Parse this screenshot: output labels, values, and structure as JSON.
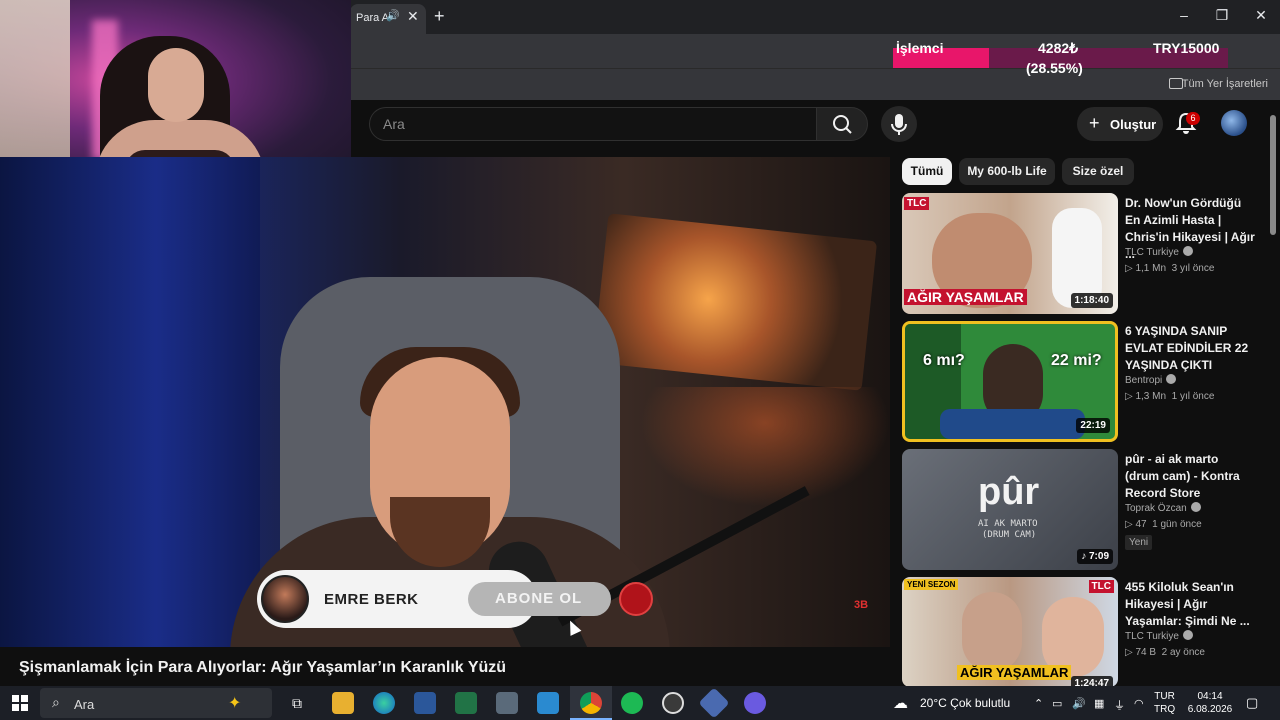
{
  "browser": {
    "tab_title": "Para A",
    "bookmarks_label": "Tüm Yer İşaretleri"
  },
  "overlay": {
    "label": "İşlemci",
    "amount": "4282₺",
    "percent_text": "(28.55%)",
    "progress": 0.2855,
    "goal": "TRY15000"
  },
  "header": {
    "search_placeholder": "Ara",
    "create_label": "Oluştur",
    "notifications_count": "6"
  },
  "player": {
    "subscribe_channel": "EMRE BERK",
    "subscribe_label": "ABONE OL"
  },
  "video": {
    "title": "Şişmanlamak İçin Para Alıyorlar: Ağır Yaşamlar’ın Karanlık Yüzü"
  },
  "chips": [
    "Tümü",
    "My 600-lb Life",
    "Size özel"
  ],
  "recommendations": [
    {
      "title": "Dr. Now'un Gördüğü En Azimli Hasta | Chris'in Hikayesi | Ağır ...",
      "channel": "TLC Turkiye",
      "views": "1,1 Mn",
      "age": "3 yıl önce",
      "duration": "1:18:40",
      "thumb_text": "AĞIR YAŞAMLAR",
      "thumb_logo": "TLC"
    },
    {
      "title": "6 YAŞINDA SANIP EVLAT EDİNDİLER 22 YAŞINDA ÇIKTI",
      "channel": "Bentropi",
      "views": "1,3 Mn",
      "age": "1 yıl önce",
      "duration": "22:19",
      "thumb_left": "6 mı?",
      "thumb_right": "22 mi?"
    },
    {
      "title": "pûr - ai ak marto (drum cam) - Kontra Record Store",
      "channel": "Toprak Özcan",
      "views": "47",
      "age": "1 gün önce",
      "duration": "7:09",
      "badge": "Yeni",
      "thumb_text": "pûr",
      "thumb_sub": "AI AK MARTO",
      "thumb_sub2": "(DRUM CAM)"
    },
    {
      "title": "455 Kiloluk Sean'ın Hikayesi | Ağır Yaşamlar: Şimdi Ne ...",
      "channel": "TLC Turkiye",
      "views": "74 B",
      "age": "2 ay önce",
      "duration": "1:24:47",
      "thumb_tag": "YENİ SEZON",
      "thumb_text": "AĞIR YAŞAMLAR",
      "thumb_logo": "TLC"
    }
  ],
  "taskbar": {
    "search_label": "Ara",
    "weather": "20°C  Çok bulutlu",
    "lang_top": "TUR",
    "lang_bottom": "TRQ",
    "time": "04:14",
    "date": "6.08.2026"
  },
  "colors": {
    "overlay_fill": "#e8166a",
    "overlay_bg": "#6a1a4a",
    "badge_red": "#cc0000"
  }
}
